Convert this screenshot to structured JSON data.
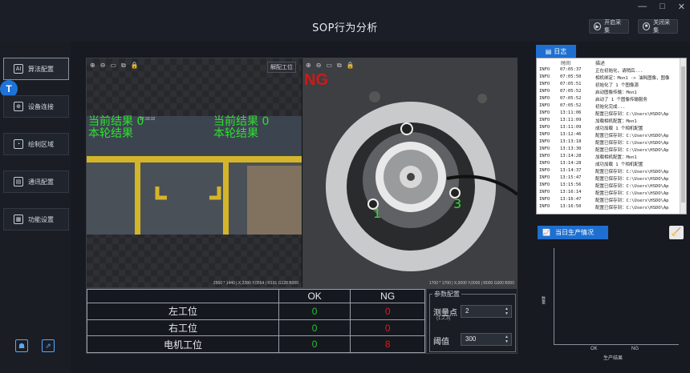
{
  "app": {
    "title": "SOP行为分析",
    "window_controls": [
      "—",
      "□",
      "✕"
    ],
    "start_collect": "开启采集",
    "stop_collect": "关闭采集"
  },
  "sidebar": {
    "logo": "T",
    "items": [
      {
        "label": "算法配置",
        "icon": "ai-icon",
        "glyph": "AI"
      },
      {
        "label": "设备连接",
        "icon": "link-icon",
        "glyph": "⊕"
      },
      {
        "label": "绘制区域",
        "icon": "draw-icon",
        "glyph": "◔"
      },
      {
        "label": "通讯配置",
        "icon": "comm-icon",
        "glyph": "▤"
      },
      {
        "label": "功能设置",
        "icon": "grid-icon",
        "glyph": "▦"
      }
    ]
  },
  "camera_left": {
    "tools": [
      "⊕",
      "⊖",
      "▭",
      "⧉",
      "🔒"
    ],
    "current_result_label": "当前结果",
    "current_result_value": "0",
    "round_result_label": "本轮结果",
    "overlay_time": "17:33:32",
    "status": "2560 * 1440  |  X,2380  Y,0554  |  R191  G128  B000"
  },
  "camera_right": {
    "tools": [
      "⊕",
      "⊖",
      "▭",
      "⧉",
      "🔒"
    ],
    "unbind": "解配工位",
    "ng": "NG",
    "marker_left": "1",
    "marker_right": "3",
    "status": "1700 * 1700  |  X,0000  Y,0000  |  R000  G000  B000"
  },
  "results": {
    "col_ok": "OK",
    "col_ng": "NG",
    "rows": [
      {
        "station": "左工位",
        "ok": "0",
        "ng": "0"
      },
      {
        "station": "右工位",
        "ok": "0",
        "ng": "0"
      },
      {
        "station": "电机工位",
        "ok": "0",
        "ng": "8"
      }
    ]
  },
  "params": {
    "title": "参数配置",
    "measure_label": "测量点",
    "measure_hint": "(1,2,3)",
    "measure_value": "2",
    "threshold_label": "阈值",
    "threshold_value": "300"
  },
  "log": {
    "tab": "日志",
    "col_time": "时间",
    "col_desc": "描述",
    "rows": [
      {
        "level": "INFO",
        "time": "07:05:37",
        "msg": "正在初始化，请稍后..."
      },
      {
        "level": "INFO",
        "time": "07:05:50",
        "msg": "相机绑定：Mon1 -> 油耗图像，图像"
      },
      {
        "level": "INFO",
        "time": "07:05:51",
        "msg": "初始化了 1 个图像源"
      },
      {
        "level": "INFO",
        "time": "07:05:52",
        "msg": "启动图像传输：Mon1"
      },
      {
        "level": "INFO",
        "time": "07:05:52",
        "msg": "启动了 1 个图像传输服务"
      },
      {
        "level": "INFO",
        "time": "07:05:52",
        "msg": "初始化完成..."
      },
      {
        "level": "INFO",
        "time": "13:11:06",
        "msg": "配置已保存到：C:\\Users\\HSDO\\Ap"
      },
      {
        "level": "INFO",
        "time": "13:11:09",
        "msg": "加载相机配置：Mon1"
      },
      {
        "level": "INFO",
        "time": "13:11:09",
        "msg": "成功加载 1 个相机配置"
      },
      {
        "level": "INFO",
        "time": "13:12:46",
        "msg": "配置已保存到：C:\\Users\\HSDO\\Ap"
      },
      {
        "level": "INFO",
        "time": "13:13:18",
        "msg": "配置已保存到：C:\\Users\\HSDO\\Ap"
      },
      {
        "level": "INFO",
        "time": "13:13:30",
        "msg": "配置已保存到：C:\\Users\\HSDO\\Ap"
      },
      {
        "level": "INFO",
        "time": "13:14:28",
        "msg": "加载相机配置：Mon1"
      },
      {
        "level": "INFO",
        "time": "13:14:28",
        "msg": "成功加载 1 个相机配置"
      },
      {
        "level": "INFO",
        "time": "13:14:37",
        "msg": "配置已保存到：C:\\Users\\HSDO\\Ap"
      },
      {
        "level": "INFO",
        "time": "13:15:47",
        "msg": "配置已保存到：C:\\Users\\HSDO\\Ap"
      },
      {
        "level": "INFO",
        "time": "13:15:56",
        "msg": "配置已保存到：C:\\Users\\HSDO\\Ap"
      },
      {
        "level": "INFO",
        "time": "13:16:14",
        "msg": "配置已保存到：C:\\Users\\HSDO\\Ap"
      },
      {
        "level": "INFO",
        "time": "13:16:47",
        "msg": "配置已保存到：C:\\Users\\HSDO\\Ap"
      },
      {
        "level": "INFO",
        "time": "13:16:50",
        "msg": "配置已保存到：C:\\Users\\HSDO\\Ap"
      }
    ]
  },
  "production": {
    "tab": "当日生产情况",
    "ylabel": "数量",
    "xlabel": "生产结果",
    "xticks": [
      "OK",
      "NG"
    ]
  },
  "chart_data": {
    "type": "bar",
    "categories": [
      "OK",
      "NG"
    ],
    "values": [
      0,
      0
    ],
    "xlabel": "生产结果",
    "ylabel": "数量"
  },
  "colors": {
    "accent": "#1e6fd0",
    "ok": "#27c22f",
    "ng": "#e11a1a",
    "overlay": "#2ee02e"
  }
}
